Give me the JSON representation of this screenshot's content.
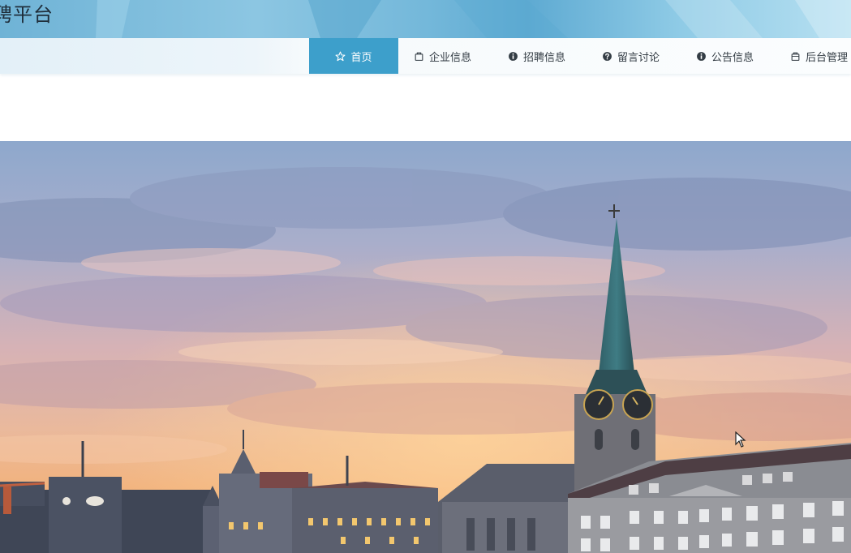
{
  "header": {
    "title": "聘平台"
  },
  "nav": {
    "items": [
      {
        "label": "首页",
        "icon": "star-icon",
        "active": true
      },
      {
        "label": "企业信息",
        "icon": "bag-icon",
        "active": false
      },
      {
        "label": "招聘信息",
        "icon": "info-circle-icon",
        "active": false
      },
      {
        "label": "留言讨论",
        "icon": "question-circle-icon",
        "active": false
      },
      {
        "label": "公告信息",
        "icon": "info-circle-icon",
        "active": false
      },
      {
        "label": "后台管理",
        "icon": "bag-icon",
        "active": false
      }
    ]
  },
  "banner": {
    "image": "zurich-fraumunster-church-sunset-skyline"
  },
  "colors": {
    "accent": "#3d9fcb",
    "header_bg": "#7cbddd",
    "nav_text": "#333c44"
  }
}
